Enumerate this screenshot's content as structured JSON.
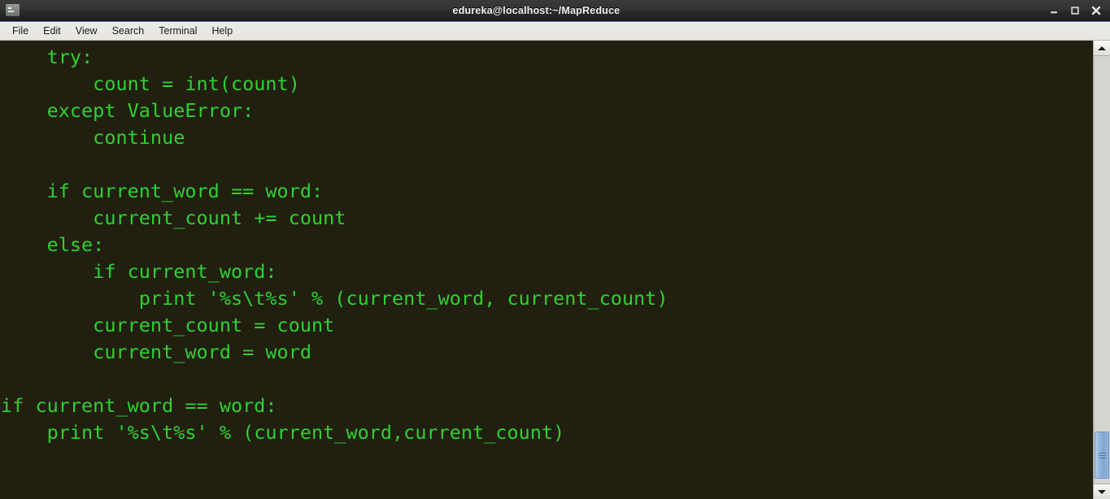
{
  "window": {
    "title": "edureka@localhost:~/MapReduce",
    "icon": "terminal-icon",
    "controls": {
      "minimize": "minimize-icon",
      "maximize": "maximize-icon",
      "close": "close-icon"
    }
  },
  "menubar": {
    "items": [
      {
        "label": "File"
      },
      {
        "label": "Edit"
      },
      {
        "label": "View"
      },
      {
        "label": "Search"
      },
      {
        "label": "Terminal"
      },
      {
        "label": "Help"
      }
    ]
  },
  "terminal": {
    "foreground": "#2fd12f",
    "background": "#211f10",
    "font_size_px": 23.5,
    "line_height_px": 33,
    "lines": [
      "    try:",
      "        count = int(count)",
      "    except ValueError:",
      "        continue",
      "",
      "    if current_word == word:",
      "        current_count += count",
      "    else:",
      "        if current_word:",
      "            print '%s\\t%s' % (current_word, current_count)",
      "        current_count = count",
      "        current_word = word",
      "",
      "if current_word == word:",
      "    print '%s\\t%s' % (current_word,current_count)",
      ""
    ]
  },
  "scrollbar": {
    "up_arrow": "chevron-up-icon",
    "down_arrow": "chevron-down-icon",
    "thumb": "scrollbar-thumb",
    "position": "near-bottom"
  }
}
